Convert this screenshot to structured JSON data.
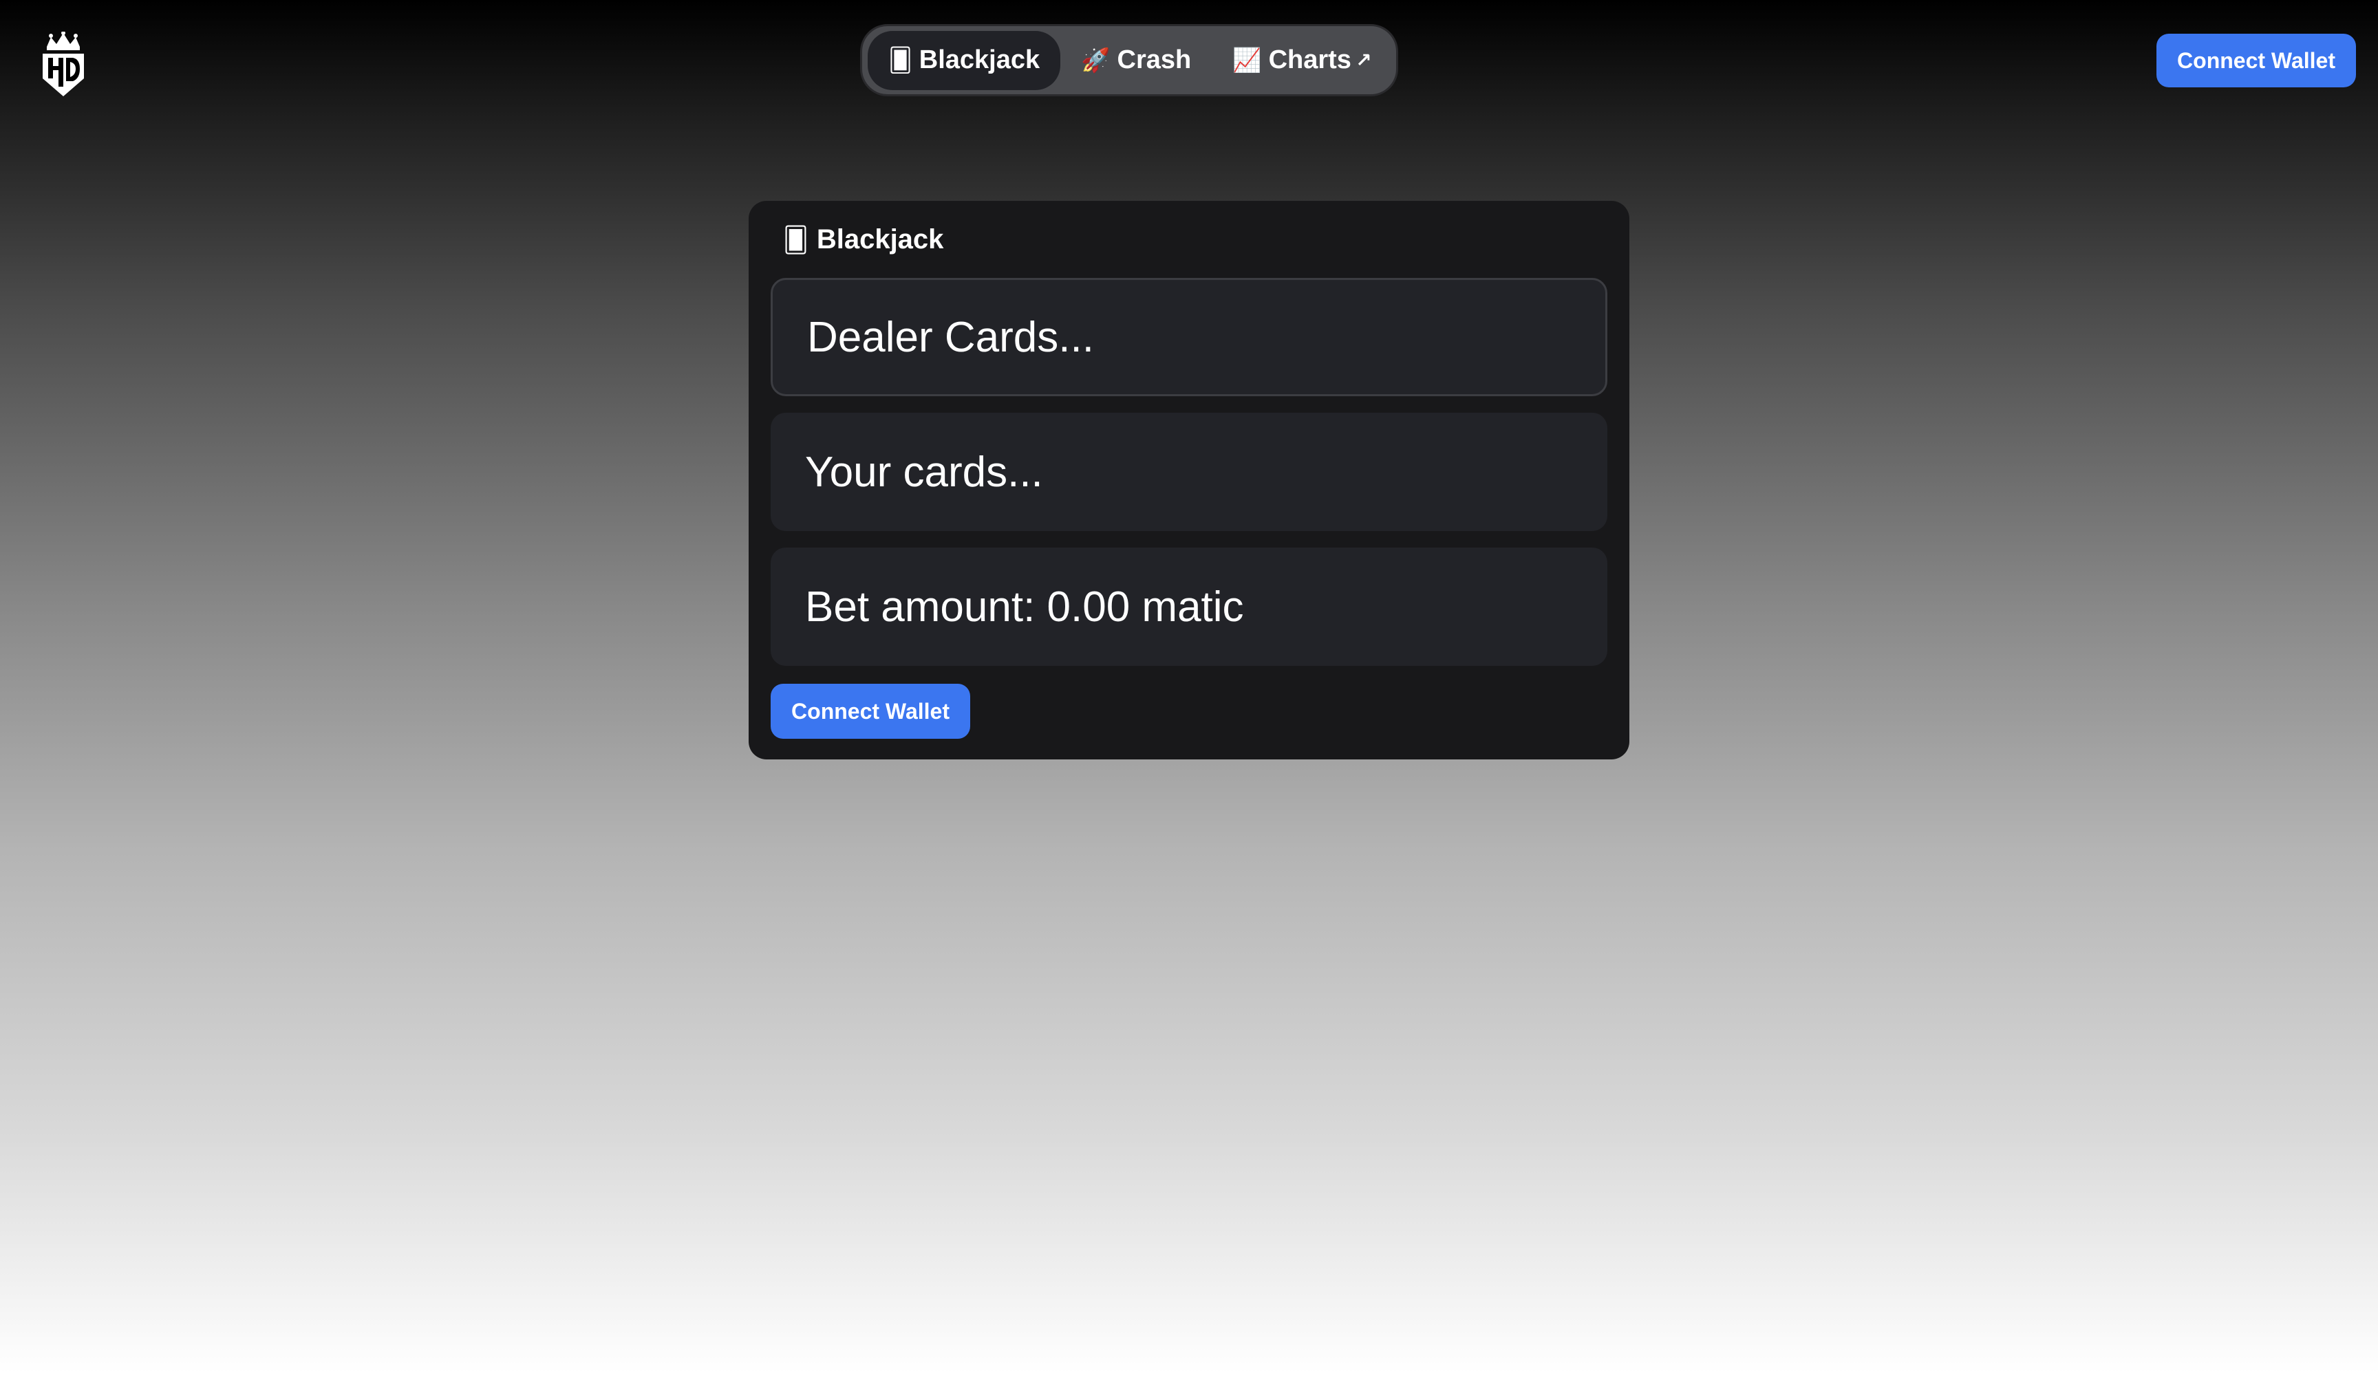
{
  "header": {
    "logo_icon": "crown-shield-logo-icon",
    "nav_tabs": [
      {
        "icon": "playing-card-icon",
        "glyph": "🂠",
        "label": "Blackjack",
        "active": true
      },
      {
        "icon": "rocket-icon",
        "glyph": "🚀",
        "label": "Crash",
        "active": false
      },
      {
        "icon": "chart-increasing-icon",
        "glyph": "📈",
        "label": "Charts",
        "external_glyph": "↗",
        "active": false
      }
    ],
    "connect_wallet_label": "Connect Wallet"
  },
  "game_card": {
    "title_glyph": "🂠",
    "title": "Blackjack",
    "dealer_cards": "Dealer Cards...",
    "your_cards": "Your cards...",
    "bet_amount": "Bet amount: 0.00 matic",
    "connect_wallet_label": "Connect Wallet"
  },
  "colors": {
    "accent_blue": "#3b76f0",
    "card_bg": "#18181a",
    "field_bg": "#222328",
    "tab_active_bg": "#212227",
    "tab_bar_bg": "#4a4b4f"
  }
}
